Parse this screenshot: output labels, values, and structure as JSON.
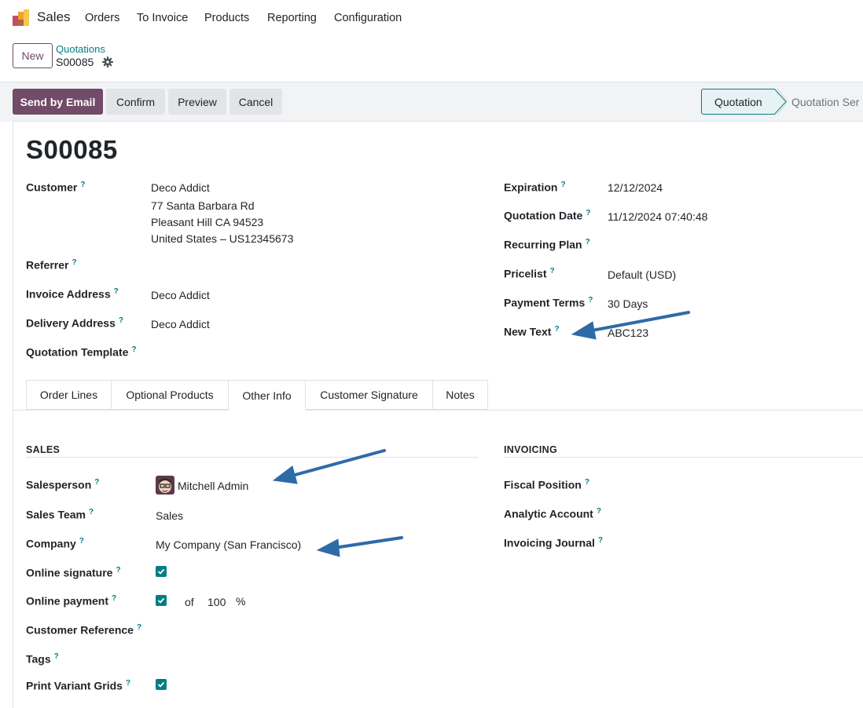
{
  "app": {
    "name": "Sales"
  },
  "menu": [
    "Orders",
    "To Invoice",
    "Products",
    "Reporting",
    "Configuration"
  ],
  "control_panel": {
    "new_label": "New",
    "breadcrumb_parent": "Quotations",
    "breadcrumb_current": "S00085"
  },
  "actions": {
    "send_by_email": "Send by Email",
    "confirm": "Confirm",
    "preview": "Preview",
    "cancel": "Cancel"
  },
  "status": {
    "active": "Quotation",
    "next": "Quotation Ser"
  },
  "record": {
    "title": "S00085",
    "left_fields": {
      "customer_label": "Customer",
      "customer_name": "Deco Addict",
      "customer_addr1": "77 Santa Barbara Rd",
      "customer_addr2": "Pleasant Hill CA 94523",
      "customer_addr3": "United States – US12345673",
      "referrer_label": "Referrer",
      "invoice_address_label": "Invoice Address",
      "invoice_address": "Deco Addict",
      "delivery_address_label": "Delivery Address",
      "delivery_address": "Deco Addict",
      "quotation_template_label": "Quotation Template"
    },
    "right_fields": {
      "expiration_label": "Expiration",
      "expiration": "12/12/2024",
      "quotation_date_label": "Quotation Date",
      "quotation_date": "11/12/2024 07:40:48",
      "recurring_plan_label": "Recurring Plan",
      "pricelist_label": "Pricelist",
      "pricelist": "Default (USD)",
      "payment_terms_label": "Payment Terms",
      "payment_terms": "30 Days",
      "new_text_label": "New Text",
      "new_text": "ABC123"
    },
    "help_mark": "?"
  },
  "tabs": [
    "Order Lines",
    "Optional Products",
    "Other Info",
    "Customer Signature",
    "Notes"
  ],
  "active_tab": "Other Info",
  "other_info": {
    "sales_section": "SALES",
    "invoicing_section": "INVOICING",
    "salesperson_label": "Salesperson",
    "salesperson": "Mitchell Admin",
    "sales_team_label": "Sales Team",
    "sales_team": "Sales",
    "company_label": "Company",
    "company": "My Company (San Francisco)",
    "online_signature_label": "Online signature",
    "online_signature": true,
    "online_payment_label": "Online payment",
    "online_payment": true,
    "payment_of": "of",
    "payment_percent": "100",
    "percent_sign": "%",
    "customer_reference_label": "Customer Reference",
    "tags_label": "Tags",
    "print_variant_grids_label": "Print Variant Grids",
    "print_variant_grids": true,
    "fiscal_position_label": "Fiscal Position",
    "analytic_account_label": "Analytic Account",
    "invoicing_journal_label": "Invoicing Journal"
  },
  "colors": {
    "brand": "#714B67",
    "accent": "#017e84",
    "annotation_arrow": "#2f6aa8"
  }
}
